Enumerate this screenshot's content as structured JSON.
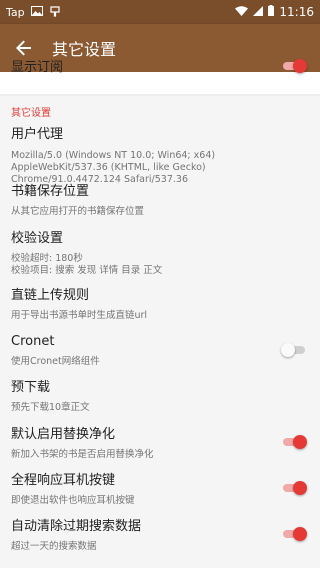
{
  "status_bar": {
    "left_text": "Tap",
    "time": "11:16"
  },
  "toolbar": {
    "title": "其它设置"
  },
  "top_item": {
    "title": "显示订阅",
    "checked": true
  },
  "section": {
    "title": "其它设置"
  },
  "items": [
    {
      "title": "用户代理",
      "summary": "Mozilla/5.0 (Windows NT 10.0; Win64; x64) AppleWebKit/537.36 (KHTML, like Gecko) Chrome/91.0.4472.124 Safari/537.36"
    },
    {
      "title": "书籍保存位置",
      "summary": "从其它应用打开的书籍保存位置"
    },
    {
      "title": "校验设置",
      "summary": "校验超时: 180秒\n校验项目: 搜索 发现 详情 目录 正文"
    },
    {
      "title": "直链上传规则",
      "summary": "用于导出书源书单时生成直链url"
    },
    {
      "title": "Cronet",
      "summary": "使用Cronet网络组件",
      "checked": false
    },
    {
      "title": "预下载",
      "summary": "预先下载10章正文"
    },
    {
      "title": "默认启用替换净化",
      "summary": "新加入书架的书是否启用替换净化",
      "checked": true
    },
    {
      "title": "全程响应耳机按键",
      "summary": "即使退出软件也响应耳机按键",
      "checked": true
    },
    {
      "title": "自动清除过期搜索数据",
      "summary": "超过一天的搜索数据",
      "checked": true
    }
  ],
  "colors": {
    "primary": "#8b5a33",
    "status_bar": "#7a4e2b",
    "accent": "#e53935"
  }
}
